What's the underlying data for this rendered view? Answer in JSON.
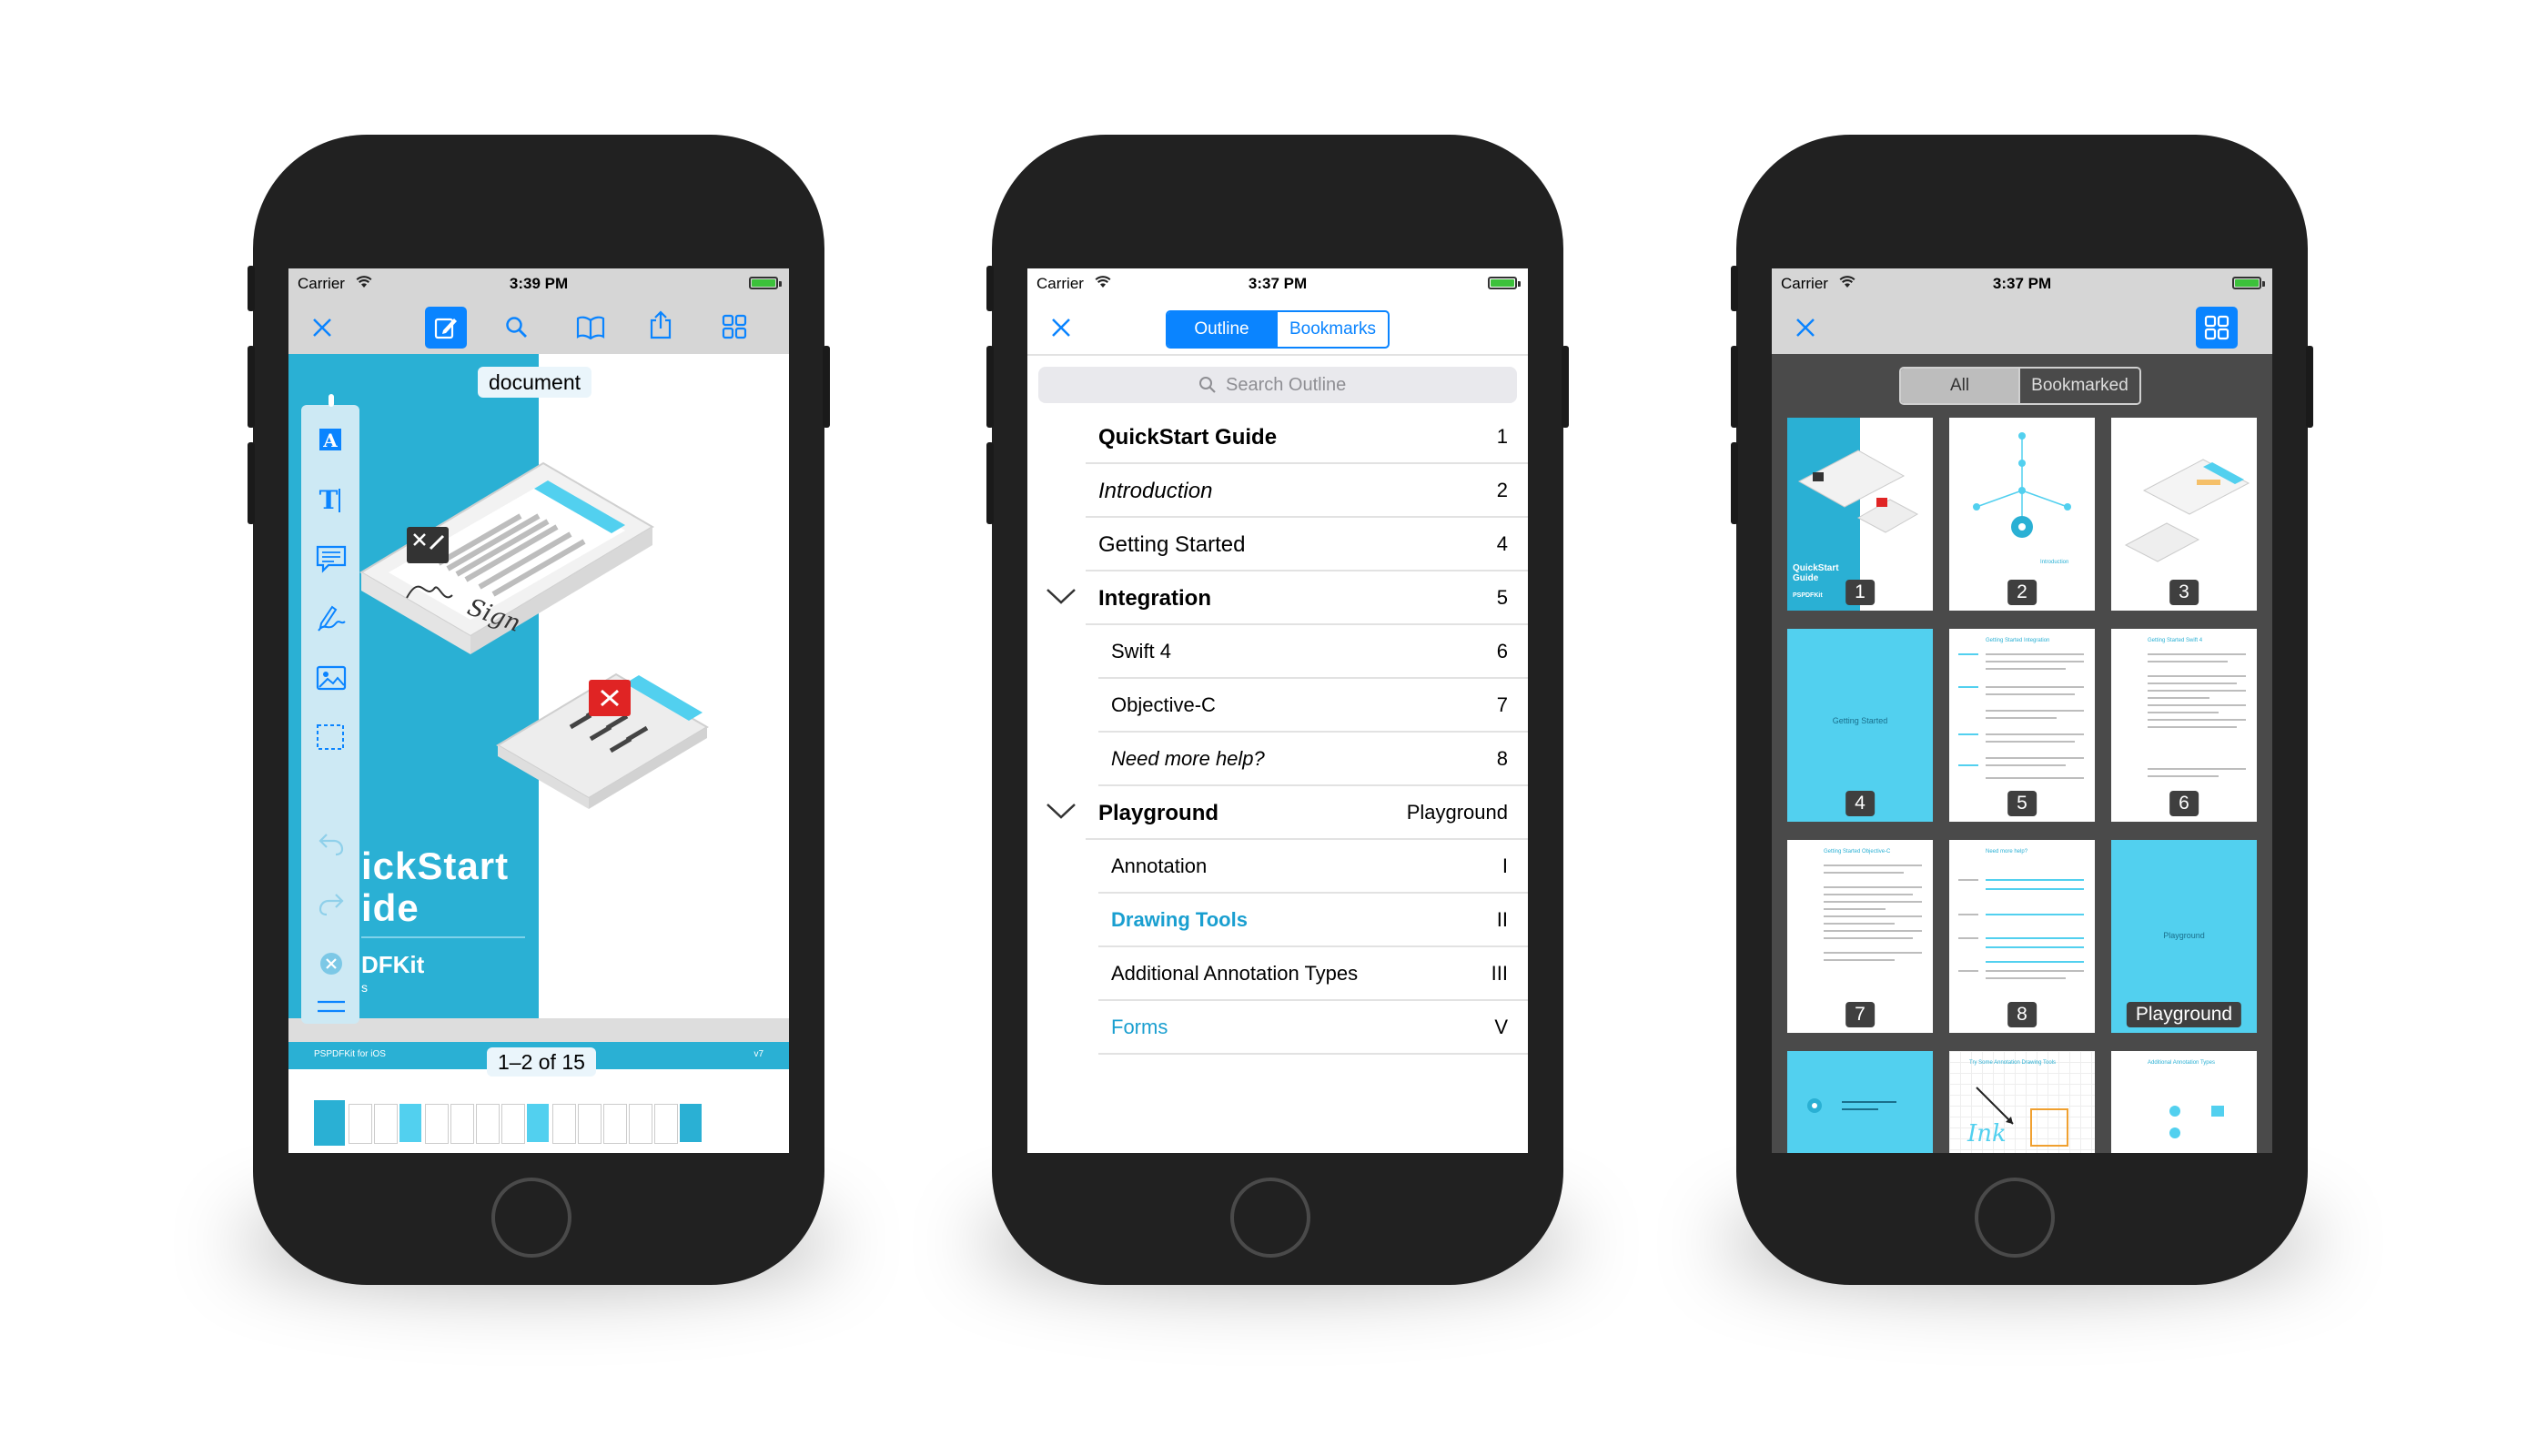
{
  "status": {
    "carrier": "Carrier",
    "time_1": "3:39 PM",
    "time_2": "3:37 PM",
    "time_3": "3:37 PM"
  },
  "colors": {
    "accent": "#0a84ff",
    "brand_blue": "#2ab0d4",
    "thumb_blue": "#52d0ef",
    "battery": "#3cc13b"
  },
  "phone1": {
    "toolbar_icons": [
      "close-icon",
      "annotate-icon",
      "search-icon",
      "outline-book-icon",
      "share-icon",
      "thumbnails-grid-icon"
    ],
    "label_document": "document",
    "cover_title_line1": "ickStart",
    "cover_title_line2": "ide",
    "cover_brand": "DFKit",
    "cover_brand_sub": "s",
    "sign_text": "Sign",
    "tools": [
      "highlight-text-icon",
      "free-text-icon",
      "note-icon",
      "ink-pen-icon",
      "image-icon",
      "selection-icon",
      "undo-icon",
      "redo-icon",
      "clear-icon",
      "collapse-icon"
    ],
    "strip_header_left": "PSPDFKit for iOS",
    "strip_header_right": "v7",
    "page_label": "1–2 of 15"
  },
  "phone2": {
    "seg_outline": "Outline",
    "seg_bookmarks": "Bookmarks",
    "search_placeholder": "Search Outline",
    "rows": [
      {
        "label": "QuickStart Guide",
        "page": "1"
      },
      {
        "label": "Introduction",
        "page": "2"
      },
      {
        "label": "Getting Started",
        "page": "4"
      },
      {
        "label": "Integration",
        "page": "5"
      },
      {
        "label": "Swift 4",
        "page": "6"
      },
      {
        "label": "Objective-C",
        "page": "7"
      },
      {
        "label": "Need more help?",
        "page": "8"
      },
      {
        "label": "Playground",
        "page": "Playground"
      },
      {
        "label": "Annotation",
        "page": "I"
      },
      {
        "label": "Drawing Tools",
        "page": "II"
      },
      {
        "label": "Additional Annotation Types",
        "page": "III"
      },
      {
        "label": "Forms",
        "page": "V"
      }
    ]
  },
  "phone3": {
    "seg_all": "All",
    "seg_bookmarked": "Bookmarked",
    "pages": [
      "1",
      "2",
      "3",
      "4",
      "5",
      "6",
      "7",
      "8",
      "Playground"
    ],
    "thumb_texts": {
      "quickstart": "QuickStart Guide",
      "pspdfkit": "PSPDFKit",
      "introduction": "Introduction",
      "getting_started": "Getting Started",
      "gs_integration": "Getting Started Integration",
      "gs_swift": "Getting Started Swift 4",
      "gs_objc": "Getting Started Objective-C",
      "need_help": "Need more help?",
      "playground": "Playground",
      "drawing_tools": "Try Some Annotation Drawing Tools",
      "ink": "Ink",
      "additional_types": "Additional Annotation Types"
    }
  }
}
